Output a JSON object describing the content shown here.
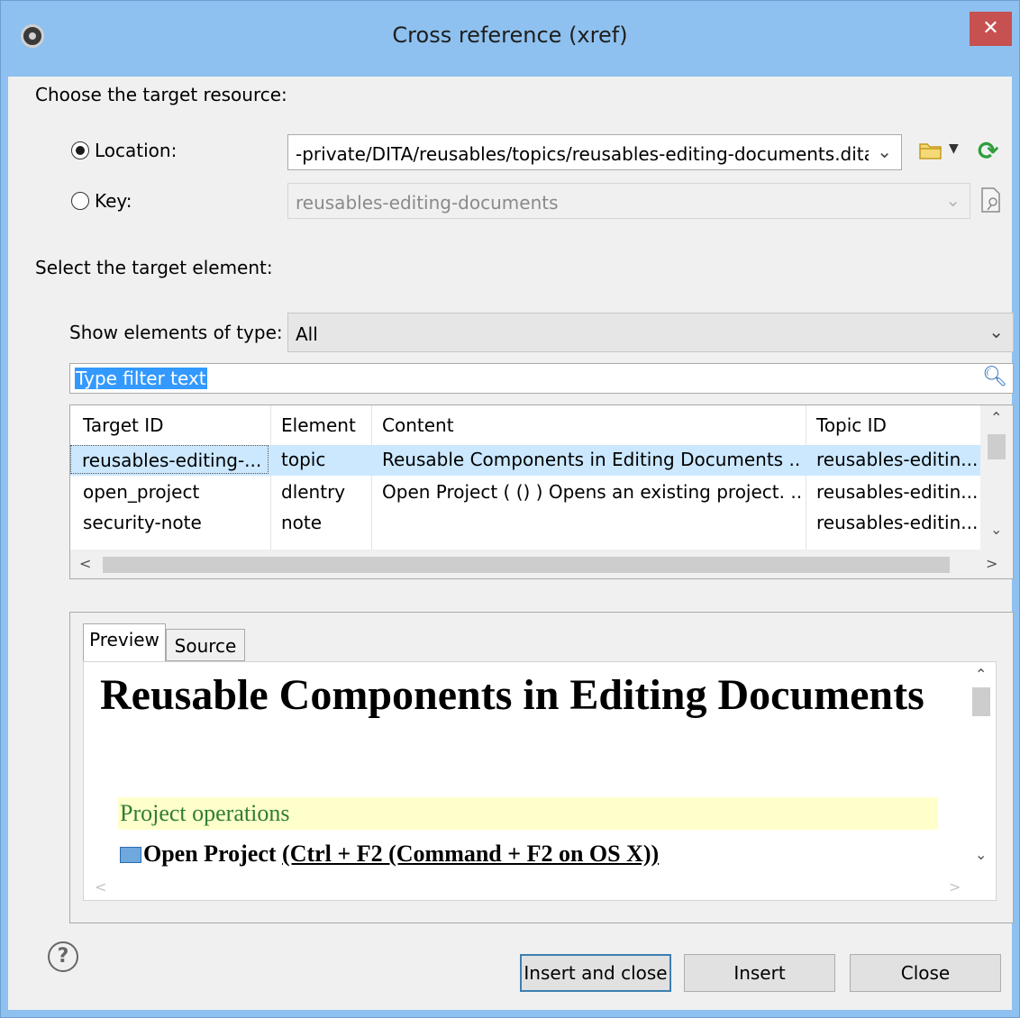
{
  "window": {
    "title": "Cross reference (xref)",
    "close_glyph": "✕",
    "icon": "gear-app-icon"
  },
  "target_resource": {
    "heading": "Choose the target resource:",
    "location": {
      "label": "Location:",
      "selected": true,
      "value": "-private/DITA/reusables/topics/reusables-editing-documents.dita"
    },
    "key": {
      "label": "Key:",
      "selected": false,
      "value": "reusables-editing-documents",
      "disabled": true
    }
  },
  "target_element": {
    "heading": "Select the target element:",
    "type_filter": {
      "label": "Show elements of type:",
      "value": "All"
    },
    "filter": {
      "placeholder": "Type filter text"
    },
    "table": {
      "columns": [
        "Target ID",
        "Element",
        "Content",
        "Topic ID"
      ],
      "rows": [
        [
          "reusables-editing-...",
          "topic",
          "Reusable Components in Editing Documents ...",
          "reusables-editin..."
        ],
        [
          "open_project",
          "dlentry",
          "Open Project ( () ) Opens an existing project. ...",
          "reusables-editin..."
        ],
        [
          "security-note",
          "note",
          "",
          "reusables-editin..."
        ]
      ],
      "selected_row": 0
    }
  },
  "preview": {
    "tabs": [
      "Preview",
      "Source"
    ],
    "active_tab": "Preview",
    "title": "Reusable Components in Editing Documents",
    "section": "Project operations",
    "entry_bold": "Open Project ",
    "entry_link": "(Ctrl + F2 (Command + F2 on OS X))"
  },
  "buttons": {
    "insert_close": "Insert and close",
    "insert": "Insert",
    "close": "Close",
    "help": "?"
  },
  "colors": {
    "title_bar": "#8ec1ef",
    "close": "#c75050",
    "selection": "#cce8ff",
    "highlight": "#3399ff",
    "section_bg": "#ffffcc",
    "section_fg": "#2e7d32",
    "refresh": "#2e9e3c",
    "folder": "#e6c15a"
  }
}
